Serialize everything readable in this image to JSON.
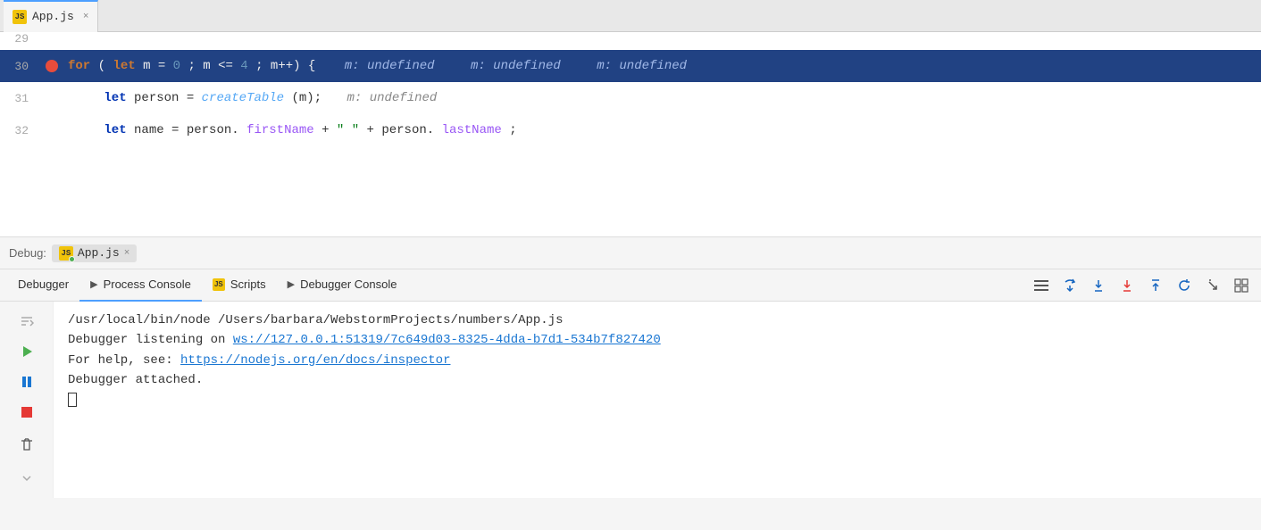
{
  "tabBar": {
    "tab": {
      "icon": "JS",
      "label": "App.js",
      "close": "×"
    }
  },
  "codeEditor": {
    "lines": [
      {
        "number": "29",
        "hasBreakpoint": false,
        "content": ""
      },
      {
        "number": "30",
        "hasBreakpoint": true,
        "highlighted": true,
        "content": "for (let m = 0; m <= 4; m++) {",
        "inlineVals": [
          "m: undefined",
          "m: undefined",
          "m: undefined"
        ]
      },
      {
        "number": "31",
        "hasBreakpoint": false,
        "highlighted": false,
        "content": "    let person = createTable(m);",
        "inlineVal": "m: undefined"
      },
      {
        "number": "32",
        "hasBreakpoint": false,
        "highlighted": false,
        "content": "    let name = person.firstName + \" \" + person.lastName;"
      }
    ]
  },
  "debugPanel": {
    "label": "Debug:",
    "session": {
      "icon": "JS",
      "label": "App.js",
      "close": "×"
    },
    "tabs": [
      {
        "id": "debugger",
        "label": "Debugger",
        "active": false,
        "icon": ""
      },
      {
        "id": "process-console",
        "label": "Process Console",
        "active": true,
        "icon": "▶"
      },
      {
        "id": "scripts",
        "label": "Scripts",
        "active": false,
        "icon": "JS"
      },
      {
        "id": "debugger-console",
        "label": "Debugger Console",
        "active": false,
        "icon": "▶"
      }
    ],
    "toolbar": {
      "buttons": [
        "≡",
        "↑",
        "↓",
        "↓red",
        "↑",
        "↺",
        "↘",
        "⊞"
      ]
    },
    "console": {
      "lines": [
        {
          "text": "/usr/local/bin/node /Users/barbara/WebstormProjects/numbers/App.js",
          "type": "plain"
        },
        {
          "text": "Debugger listening on ",
          "type": "plain",
          "link": "ws://127.0.0.1:51319/7c649d03-8325-4dda-b7d1-534b7f827420",
          "linkType": "ws"
        },
        {
          "text": "For help, see: ",
          "type": "plain",
          "link": "https://nodejs.org/en/docs/inspector",
          "linkType": "https"
        },
        {
          "text": "Debugger attached.",
          "type": "plain"
        }
      ]
    }
  }
}
